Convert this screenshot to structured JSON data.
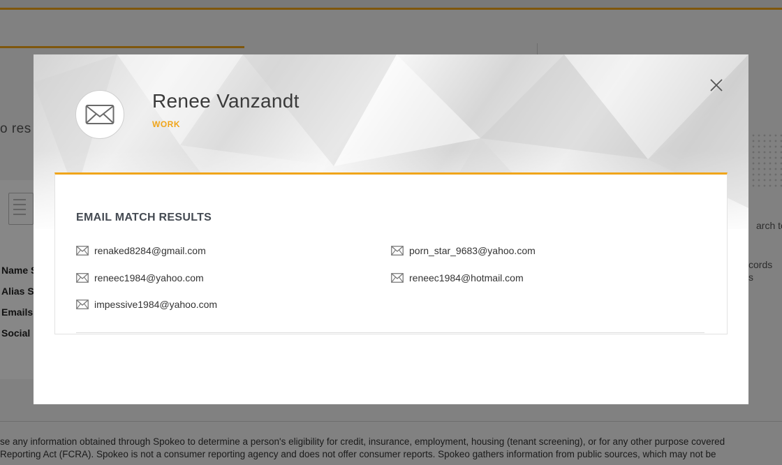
{
  "background": {
    "no_results_text": "o res",
    "labels": [
      "Name S",
      "Alias S",
      "Emails",
      "Social "
    ],
    "right_texts": [
      "arch to",
      "cords",
      "s"
    ],
    "footer_lines": [
      "se any information obtained through Spokeo to determine a person's eligibility for credit, insurance, employment, housing (tenant screening), or for any other purpose covered",
      "Reporting Act (FCRA). Spokeo is not a consumer reporting agency and does not offer consumer reports. Spokeo gathers information from public sources, which may not be"
    ]
  },
  "modal": {
    "person_name": "Renee Vanzandt",
    "tag": "WORK",
    "avatar_icon": "envelope-icon",
    "close_icon": "close-icon",
    "section_title": "EMAIL MATCH RESULTS",
    "emails": [
      "renaked8284@gmail.com",
      "porn_star_9683@yahoo.com",
      "reneec1984@yahoo.com",
      "reneec1984@hotmail.com",
      "impessive1984@yahoo.com"
    ],
    "email_icon": "envelope-icon"
  },
  "colors": {
    "accent": "#f0a51a",
    "overlay": "rgba(0,0,0,0.47)",
    "title_text": "#444a52"
  }
}
